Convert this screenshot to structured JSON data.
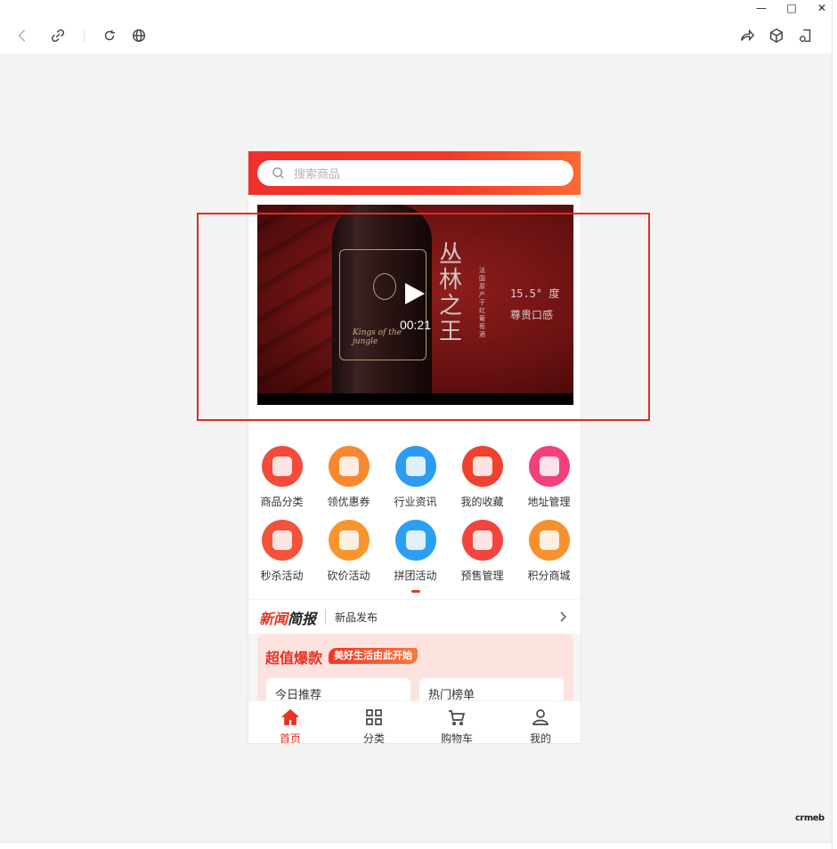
{
  "window": {
    "controls": [
      "—",
      "□",
      "✕"
    ]
  },
  "toolbar": {
    "icons": [
      "back-icon",
      "link-icon",
      "refresh-icon",
      "globe-icon",
      "share-icon",
      "cube-icon",
      "page-settings-icon"
    ]
  },
  "search": {
    "placeholder": "搜索商品"
  },
  "video": {
    "duration": "00:21",
    "title_chars": "丛林之王",
    "subtitle": "法国原产干红葡萄酒",
    "right_text_1": "15.5° 度",
    "right_text_2": "尊贵口感",
    "bottle_script": "Kings of the jungle"
  },
  "menu": {
    "items": [
      {
        "label": "商品分类",
        "icon": "shopping-bag-icon",
        "color": "#f24b3b"
      },
      {
        "label": "领优惠券",
        "icon": "coupon-icon",
        "color": "#f7882f"
      },
      {
        "label": "行业资讯",
        "icon": "news-document-icon",
        "color": "#2c9cf2"
      },
      {
        "label": "我的收藏",
        "icon": "star-favorite-icon",
        "color": "#f0412e"
      },
      {
        "label": "地址管理",
        "icon": "location-icon",
        "color": "#f2417a"
      },
      {
        "label": "秒杀活动",
        "icon": "flash-sale-icon",
        "color": "#f4523c"
      },
      {
        "label": "砍价活动",
        "icon": "bargain-icon",
        "color": "#f7952e"
      },
      {
        "label": "拼团活动",
        "icon": "group-buy-icon",
        "color": "#2d9ff3"
      },
      {
        "label": "预售管理",
        "icon": "diamond-presale-icon",
        "color": "#f2453d"
      },
      {
        "label": "积分商城",
        "icon": "points-mall-icon",
        "color": "#f5912f"
      }
    ]
  },
  "news": {
    "logo_part1": "新闻",
    "logo_part2": "简报",
    "text": "新品发布"
  },
  "promo": {
    "title": "超值爆款",
    "tag": "美好生活由此开始",
    "card1": "今日推荐",
    "card2": "热门榜单"
  },
  "tabbar": {
    "items": [
      {
        "label": "首页",
        "icon": "home-icon",
        "active": true
      },
      {
        "label": "分类",
        "icon": "grid-icon",
        "active": false
      },
      {
        "label": "购物车",
        "icon": "cart-icon",
        "active": false
      },
      {
        "label": "我的",
        "icon": "user-icon",
        "active": false
      }
    ]
  },
  "brand": "crmeb",
  "colors": {
    "accent": "#e93323",
    "highlight": "#e12a22",
    "header_gradient_start": "#f0302b",
    "header_gradient_end": "#fb6a32"
  }
}
